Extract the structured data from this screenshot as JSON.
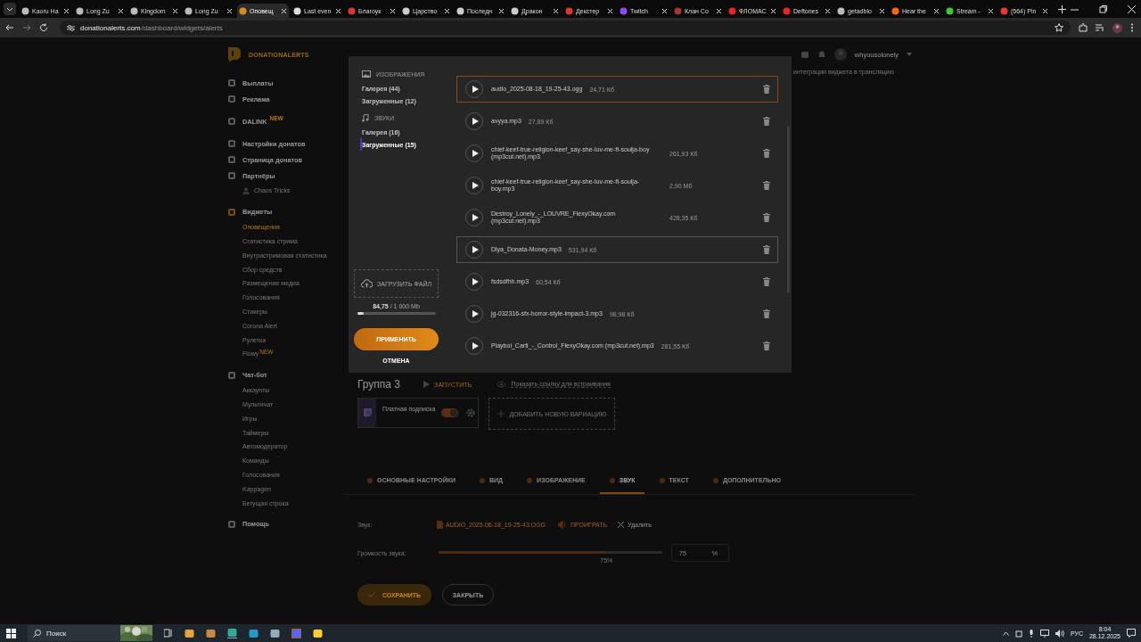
{
  "browser": {
    "tabs": [
      {
        "title": "Kaoru Ha",
        "selected": false
      },
      {
        "title": "Long Zu",
        "selected": false
      },
      {
        "title": "Kingdom",
        "selected": false
      },
      {
        "title": "Long Zu",
        "selected": false
      },
      {
        "title": "Оповещ",
        "selected": true
      },
      {
        "title": "Last even",
        "selected": false
      },
      {
        "title": "Благоук",
        "selected": false
      },
      {
        "title": "Царство",
        "selected": false
      },
      {
        "title": "Последн",
        "selected": false
      },
      {
        "title": "Дракон",
        "selected": false
      },
      {
        "title": "Декстер",
        "selected": false
      },
      {
        "title": "Twitch",
        "selected": false
      },
      {
        "title": "Клан Со",
        "selected": false
      },
      {
        "title": "ФЛОМАС",
        "selected": false
      },
      {
        "title": "Deftones",
        "selected": false
      },
      {
        "title": "getadblo",
        "selected": false
      },
      {
        "title": "Hear the",
        "selected": false
      },
      {
        "title": "Stream -",
        "selected": false
      },
      {
        "title": "(564) Pin",
        "selected": false
      }
    ],
    "url": {
      "domain": "donationalerts.com",
      "path": "/dashboard/widgets/alerts"
    }
  },
  "sidebar": {
    "logo": "DONATIONALERTS",
    "groups": [
      [
        {
          "label": "Выплаты",
          "selected": false
        },
        {
          "label": "Реклама",
          "selected": false
        }
      ],
      [
        {
          "label": "DALINK",
          "badge": "NEW",
          "selected": false
        }
      ],
      [
        {
          "label": "Настройки донатов",
          "selected": false
        },
        {
          "label": "Страница донатов",
          "selected": false
        },
        {
          "label": "Партнёры",
          "selected": false,
          "children": [
            {
              "label": "Chaos Tricks",
              "selected": false
            }
          ]
        }
      ],
      [
        {
          "label": "Виджеты",
          "selected": true,
          "children": [
            {
              "label": "Оповещения",
              "selected": true
            },
            {
              "label": "Статистика стрима",
              "selected": false
            },
            {
              "label": "Внутристримовая статистика",
              "selected": false
            },
            {
              "label": "Сбор средств",
              "selected": false
            },
            {
              "label": "Размещение медиа",
              "selected": false
            },
            {
              "label": "Голосования",
              "selected": false
            },
            {
              "label": "Стикеры",
              "selected": false
            },
            {
              "label": "Corona Alert",
              "selected": false
            },
            {
              "label": "Рулетка",
              "selected": false
            },
            {
              "label": "Flowy",
              "badge": "NEW",
              "selected": false
            }
          ]
        }
      ],
      [
        {
          "label": "Чат-бот",
          "selected": false,
          "children": [
            {
              "label": "Аккаунты",
              "selected": false
            },
            {
              "label": "Мультичат",
              "selected": false
            },
            {
              "label": "Игры",
              "selected": false
            },
            {
              "label": "Таймеры",
              "selected": false
            },
            {
              "label": "Автомодератор",
              "selected": false
            },
            {
              "label": "Команды",
              "selected": false
            },
            {
              "label": "Голосования",
              "selected": false
            },
            {
              "label": "Kappagen",
              "selected": false
            },
            {
              "label": "Бегущая строка",
              "selected": false
            }
          ]
        }
      ],
      [
        {
          "label": "Помощь",
          "selected": false
        }
      ]
    ]
  },
  "header": {
    "username": "whyousolonely",
    "notice": "интеграции виджета в трансляцию"
  },
  "group": {
    "title": "Группа 3",
    "run": "ЗАПУСТИТЬ",
    "embed_link": "Показать ссылку для встраивания",
    "variation": {
      "title": "Платная подписка",
      "on": true
    },
    "add_variation": "ДОБАВИТЬ НОВУЮ ВАРИАЦИЮ"
  },
  "settings_tabs": [
    {
      "label": "ОСНОВНЫЕ НАСТРОЙКИ",
      "selected": false
    },
    {
      "label": "ВИД",
      "selected": false
    },
    {
      "label": "ИЗОБРАЖЕНИЕ",
      "selected": false
    },
    {
      "label": "ЗВУК",
      "selected": true
    },
    {
      "label": "ТЕКСТ",
      "selected": false
    },
    {
      "label": "ДОПОЛНИТЕЛЬНО",
      "selected": false
    }
  ],
  "sound": {
    "label": "Звук:",
    "file": "AUDIO_2025-08-18_19-25-43.OGG",
    "play": "ПРОИГРАТЬ",
    "remove": "Удалить"
  },
  "volume": {
    "label": "Громкость звука:",
    "level": 0.75,
    "reading": "75%",
    "value": "75",
    "unit": "%"
  },
  "actions": {
    "save": "СОХРАНИТЬ",
    "close": "ЗАКРЫТЬ"
  },
  "library": {
    "categories": [
      {
        "title": "ИЗОБРАЖЕНИЯ",
        "items": [
          {
            "label": "Галерея (44)",
            "selected": false
          },
          {
            "label": "Загруженные (12)",
            "selected": false
          }
        ]
      },
      {
        "title": "ЗВУКИ",
        "items": [
          {
            "label": "Галерея (16)",
            "selected": false
          },
          {
            "label": "Загруженные (15)",
            "selected": true
          }
        ]
      }
    ],
    "upload": "ЗАГРУЗИТЬ ФАЙЛ",
    "storage": {
      "used": "84,75",
      "total": "/ 1 000 Mb",
      "level": 0.085
    },
    "apply": "ПРИМЕНИТЬ",
    "cancel": "ОТМЕНА",
    "files": [
      {
        "name": "audio_2025-08-18_19-25-43.ogg",
        "size": "24,71 Кб",
        "selected": true,
        "hovered": false
      },
      {
        "name": "avyya.mp3",
        "size": "27,89 Кб",
        "selected": false,
        "hovered": false
      },
      {
        "name": "chief-keef-true-religion-keef_say-she-luv-me-ft-soulja-boy (mp3cut.net).mp3",
        "size": "261,93 Кб",
        "selected": false,
        "hovered": false
      },
      {
        "name": "chief-keef-true-religion-keef_say-she-luv-me-ft-soulja-boy.mp3",
        "size": "2,90 Мб",
        "selected": false,
        "hovered": false
      },
      {
        "name": "Destroy_Lonely_-_LOUVRE_FlexyOkay.com (mp3cut.net).mp3",
        "size": "428,35 Кб",
        "selected": false,
        "hovered": false
      },
      {
        "name": "Dlya_Donata-Money.mp3",
        "size": "531,94 Кб",
        "selected": false,
        "hovered": true
      },
      {
        "name": "fsdsdfhh.mp3",
        "size": "60,54 Кб",
        "selected": false,
        "hovered": false
      },
      {
        "name": "jg-032316-sfx-horror-style-impact-3.mp3",
        "size": "98,98 Кб",
        "selected": false,
        "hovered": false
      },
      {
        "name": "Playboi_Carti_-_Control_FlexyOkay.com (mp3cut.net).mp3",
        "size": "281,55 Кб",
        "selected": false,
        "hovered": false
      }
    ]
  },
  "taskbar": {
    "search": "Поиск",
    "language": "РУС",
    "time": "8:04",
    "date": "28.12.2025"
  }
}
